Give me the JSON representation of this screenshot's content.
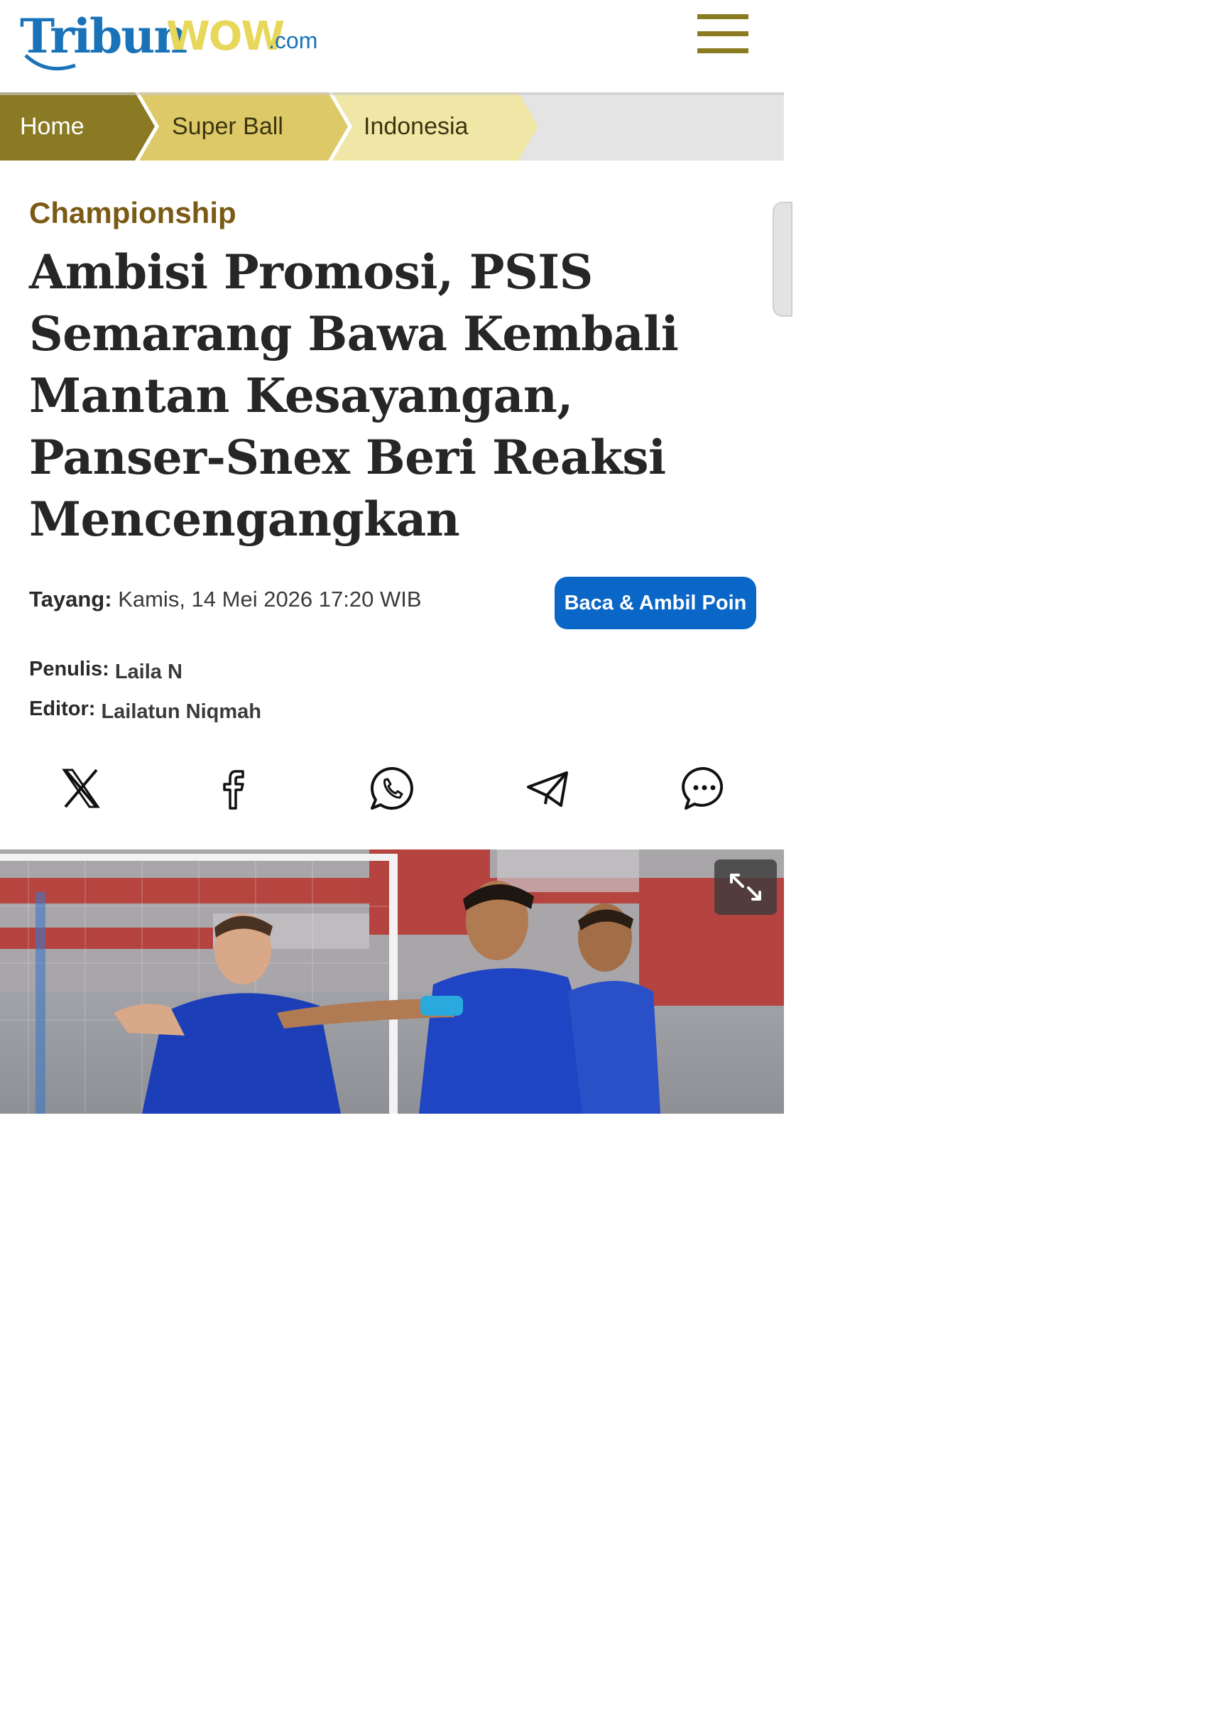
{
  "site": {
    "logo_main": "Tribun",
    "logo_accent": "WOW",
    "logo_suffix": ".com"
  },
  "breadcrumb": [
    {
      "label": "Home"
    },
    {
      "label": "Super Ball"
    },
    {
      "label": "Indonesia"
    }
  ],
  "article": {
    "category": "Championship",
    "headline": "Ambisi Promosi, PSIS Semarang Bawa Kembali Mantan Kesayangan, Panser-Snex Beri Reaksi Mencengangkan",
    "tayang_label": "Tayang:",
    "tayang_value": "Kamis, 14 Mei 2026 17:20 WIB",
    "penulis_label": "Penulis:",
    "penulis_value": "Laila N",
    "editor_label": "Editor:",
    "editor_value": "Lailatun Niqmah",
    "cta_label": "Baca & Ambil Poin"
  },
  "share_icons": [
    "x-icon",
    "facebook-icon",
    "whatsapp-icon",
    "telegram-icon",
    "comment-icon"
  ],
  "colors": {
    "accent_gold": "#8a7a20",
    "category_brown": "#7a5a14",
    "cta_blue": "#0a66c7",
    "logo_blue": "#1a73b8",
    "logo_yellow": "#e8d85a"
  }
}
